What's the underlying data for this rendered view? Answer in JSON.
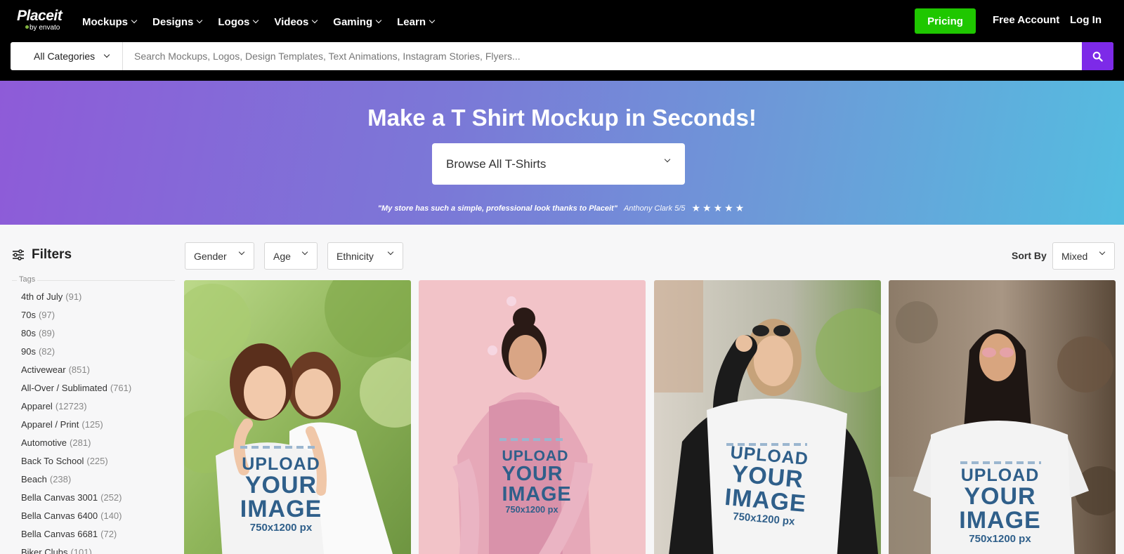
{
  "brand": {
    "name": "Placeit",
    "sub": "by envato"
  },
  "nav": {
    "items": [
      {
        "label": "Mockups"
      },
      {
        "label": "Designs"
      },
      {
        "label": "Logos"
      },
      {
        "label": "Videos"
      },
      {
        "label": "Gaming"
      },
      {
        "label": "Learn"
      }
    ],
    "pricing": "Pricing",
    "free_account": "Free Account",
    "login": "Log In"
  },
  "search": {
    "category": "All Categories",
    "placeholder": "Search Mockups, Logos, Design Templates, Text Animations, Instagram Stories, Flyers..."
  },
  "hero": {
    "title": "Make a T Shirt Mockup in Seconds!",
    "browse": "Browse All T-Shirts",
    "quote": "\"My store has such a simple, professional look thanks to Placeit\"",
    "author": "Anthony Clark 5/5",
    "stars": "★★★★★"
  },
  "filters": {
    "title": "Filters",
    "tags_label": "Tags",
    "tags": [
      {
        "name": "4th of July",
        "count": "(91)"
      },
      {
        "name": "70s",
        "count": "(97)"
      },
      {
        "name": "80s",
        "count": "(89)"
      },
      {
        "name": "90s",
        "count": "(82)"
      },
      {
        "name": "Activewear",
        "count": "(851)"
      },
      {
        "name": "All-Over / Sublimated",
        "count": "(761)"
      },
      {
        "name": "Apparel",
        "count": "(12723)"
      },
      {
        "name": "Apparel / Print",
        "count": "(125)"
      },
      {
        "name": "Automotive",
        "count": "(281)"
      },
      {
        "name": "Back To School",
        "count": "(225)"
      },
      {
        "name": "Beach",
        "count": "(238)"
      },
      {
        "name": "Bella Canvas 3001",
        "count": "(252)"
      },
      {
        "name": "Bella Canvas 6400",
        "count": "(140)"
      },
      {
        "name": "Bella Canvas 6681",
        "count": "(72)"
      },
      {
        "name": "Biker Clubs",
        "count": "(101)"
      }
    ]
  },
  "dropdowns": {
    "gender": "Gender",
    "age": "Age",
    "ethnicity": "Ethnicity"
  },
  "sort": {
    "label": "Sort By",
    "value": "Mixed"
  },
  "cards": [
    {
      "upload": "UPLOAD",
      "your": "YOUR",
      "image": "IMAGE",
      "size": "750x1200 px"
    },
    {
      "upload": "UPLOAD",
      "your": "YOUR",
      "image": "IMAGE",
      "size": "750x1200 px"
    },
    {
      "upload": "UPLOAD",
      "your": "YOUR",
      "image": "IMAGE",
      "size": "750x1200 px"
    },
    {
      "upload": "UPLOAD",
      "your": "YOUR",
      "image": "IMAGE",
      "size": "750x1200 px"
    }
  ],
  "colors": {
    "accent": "#7d2ae8",
    "pricing": "#1fc700",
    "topbar": "#000000"
  }
}
